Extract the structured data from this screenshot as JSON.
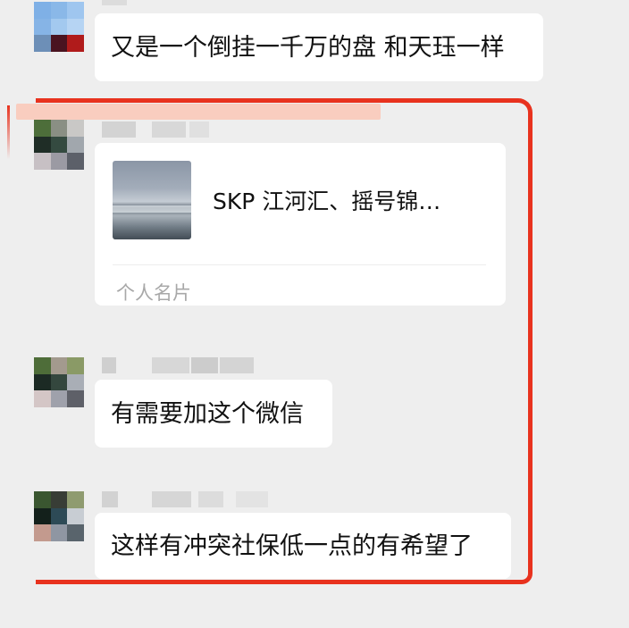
{
  "messages": [
    {
      "text": "又是一个倒挂一千万的盘 和天珏一样"
    },
    {
      "card": {
        "title": "SKP 江河汇、摇号锦…",
        "type_label": "个人名片"
      }
    },
    {
      "text": "有需要加这个微信"
    },
    {
      "text": "这样有冲突社保低一点的有希望了"
    }
  ],
  "colors": {
    "background": "#eeeeee",
    "bubble": "#ffffff",
    "annotation_red": "#e8321e",
    "highlight": "#f9cdbf"
  }
}
